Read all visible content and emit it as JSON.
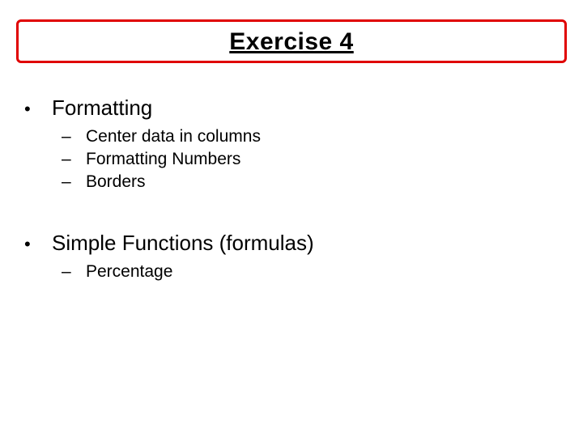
{
  "title": "Exercise 4",
  "groups": [
    {
      "label": "Formatting",
      "subs": [
        "Center data in columns",
        "Formatting Numbers",
        "Borders"
      ]
    },
    {
      "label": "Simple Functions (formulas)",
      "subs": [
        "Percentage"
      ]
    }
  ]
}
